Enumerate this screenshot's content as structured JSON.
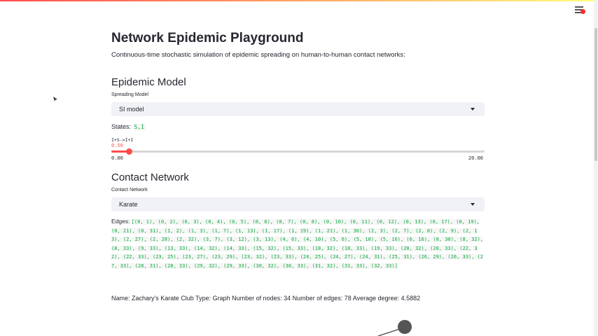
{
  "app": {
    "title": "Network Epidemic Playground",
    "subtitle": "Continuous-time stochastic simulation of epidemic spreading on human-to-human contact networks:"
  },
  "header": {
    "menu_icon": "hamburger-menu-icon"
  },
  "epidemic_model": {
    "heading": "Epidemic Model",
    "spreading_label": "Spreading Model",
    "spreading_value": "SI model",
    "states_label": "States:",
    "states_value": "S,I",
    "slider": {
      "label": "I+S->I+I",
      "value": "0.50",
      "value_num": 0.5,
      "min": "0.00",
      "max": "20.00",
      "min_num": 0,
      "max_num": 20
    }
  },
  "contact_network": {
    "heading": "Contact Network",
    "network_label": "Contact Network",
    "network_value": "Karate",
    "edges_label": "Edges:",
    "edges_value": "[(0, 1), (0, 2), (0, 3), (0, 4), (0, 5), (0, 6), (0, 7), (0, 8), (0, 10), (0, 11), (0, 12), (0, 13), (0, 17), (0, 19), (0, 21), (0, 31), (1, 2), (1, 3), (1, 7), (1, 13), (1, 17), (1, 19), (1, 21), (1, 30), (2, 3), (2, 7), (2, 8), (2, 9), (2, 13), (2, 27), (2, 28), (2, 32), (3, 7), (3, 12), (3, 13), (4, 6), (4, 10), (5, 6), (5, 10), (5, 16), (6, 16), (8, 30), (8, 32), (8, 33), (9, 33), (13, 33), (14, 32), (14, 33), (15, 32), (15, 33), (18, 32), (18, 33), (19, 33), (20, 32), (20, 33), (22, 32), (22, 33), (23, 25), (23, 27), (23, 29), (23, 32), (23, 33), (24, 25), (24, 27), (24, 31), (25, 31), (26, 29), (26, 33), (27, 33), (28, 31), (28, 33), (29, 32), (29, 33), (30, 32), (30, 33), (31, 32), (31, 33), (32, 33)]",
    "info": "Name: Zachary's Karate Club Type: Graph Number of nodes: 34 Number of edges: 78 Average degree: 4.5882"
  },
  "colors": {
    "accent": "#ff4b4b",
    "code_green": "#09ab3b",
    "select_bg": "#f0f2f6",
    "node": "#555555"
  }
}
